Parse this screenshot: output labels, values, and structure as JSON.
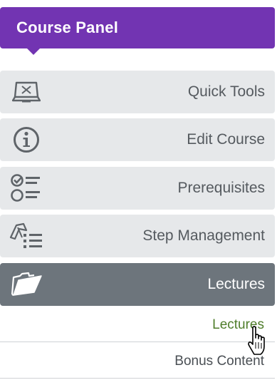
{
  "header": {
    "title": "Course Panel",
    "color": "#7234b2"
  },
  "menu": {
    "items": [
      {
        "label": "Quick Tools",
        "icon": "book-open-icon",
        "active": false
      },
      {
        "label": "Edit Course",
        "icon": "info-icon",
        "active": false
      },
      {
        "label": "Prerequisites",
        "icon": "checklist-icon",
        "active": false
      },
      {
        "label": "Step Management",
        "icon": "steps-list-icon",
        "active": false
      },
      {
        "label": "Lectures",
        "icon": "folder-open-icon",
        "active": true
      }
    ],
    "active_color": "#6d757c",
    "item_color": "#e6e8ea"
  },
  "submenu": {
    "items": [
      {
        "label": "Lectures",
        "current": true
      },
      {
        "label": "Bonus Content",
        "current": false
      }
    ],
    "current_color": "#4f7d2b"
  },
  "cursor": {
    "icon": "hand-pointer-icon"
  }
}
